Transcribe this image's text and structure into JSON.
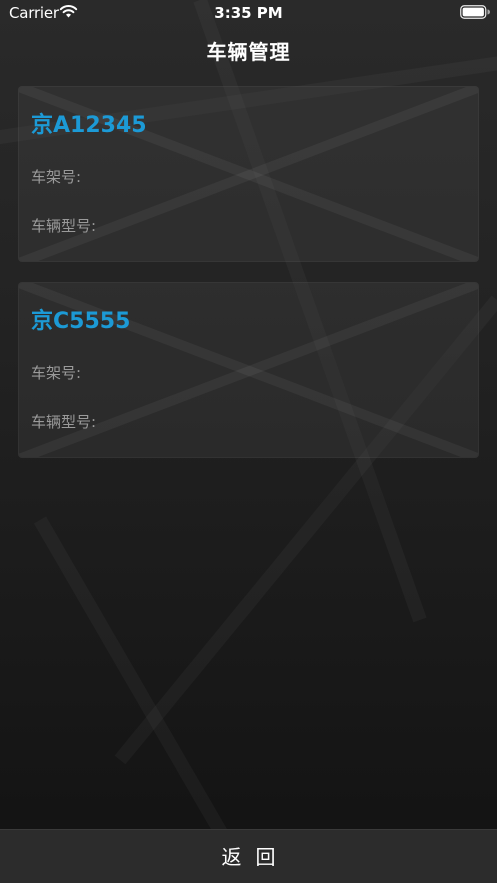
{
  "status_bar": {
    "carrier": "Carrier",
    "time": "3:35 PM",
    "wifi_icon": "wifi-icon",
    "battery_icon": "battery-icon"
  },
  "nav": {
    "title": "车辆管理"
  },
  "vehicles": [
    {
      "plate": "京A12345",
      "frame_label": "车架号:",
      "model_label": "车辆型号:"
    },
    {
      "plate": "京C5555",
      "frame_label": "车架号:",
      "model_label": "车辆型号:"
    }
  ],
  "bottom": {
    "back_label": "返回"
  },
  "colors": {
    "accent": "#1c9ad6",
    "label": "#9a9a9a",
    "background": "#1b1b1b",
    "bottom_bar": "#2c2c2c"
  }
}
